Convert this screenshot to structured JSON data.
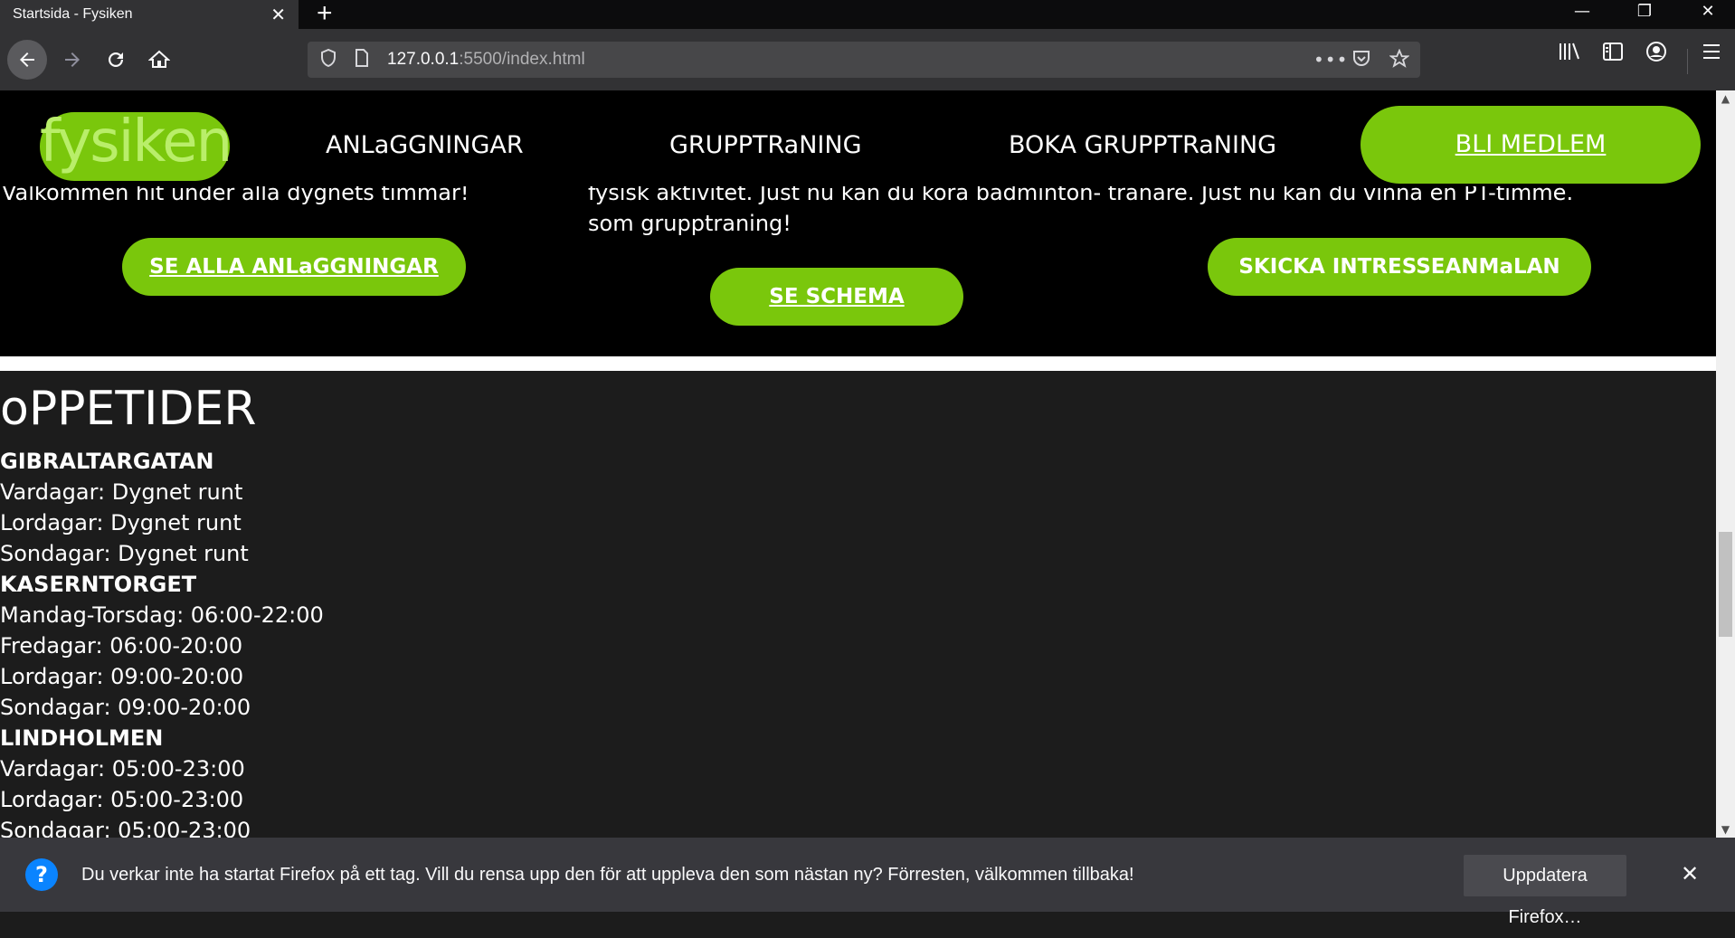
{
  "browser": {
    "tab_title": "Startsida - Fysiken",
    "tab_close": "✕",
    "new_tab": "+",
    "url_host": "127.0.0.1",
    "url_rest": ":5500/index.html",
    "page_actions": "•••",
    "window": {
      "minimize": "—",
      "restore": "❐",
      "close": "✕"
    }
  },
  "header": {
    "logo": "fysiken",
    "menu": [
      "ANLaGGNINGAR",
      "GRUPPTRaNING",
      "BOKA GRUPPTRaNING"
    ],
    "cta": "BLI MEDLEM"
  },
  "hero": {
    "col1_text": "Välkommen hit under alla dygnets timmar!",
    "col1_button": "SE ALLA ANLaGGNINGAR",
    "col2_text_line1": "fysisk aktivitet. Just nu kan du köra badminton- tränare. Just nu kan du vinna en PT-timme.",
    "col2_text_line2": "som grupptraning!",
    "col2_button": "SE SCHEMA",
    "col3_button": "SKICKA INTRESSEANMaLAN"
  },
  "hours": {
    "title": "oPPETIDER",
    "lines": [
      {
        "text": "GIBRALTARGATAN",
        "bold": true
      },
      {
        "text": "Vardagar: Dygnet runt",
        "bold": false
      },
      {
        "text": "Lordagar: Dygnet runt",
        "bold": false
      },
      {
        "text": "Sondagar: Dygnet runt",
        "bold": false
      },
      {
        "text": "KASERNTORGET",
        "bold": true
      },
      {
        "text": "Mandag-Torsdag: 06:00-22:00",
        "bold": false
      },
      {
        "text": "Fredagar: 06:00-20:00",
        "bold": false
      },
      {
        "text": "Lordagar: 09:00-20:00",
        "bold": false
      },
      {
        "text": "Sondagar: 09:00-20:00",
        "bold": false
      },
      {
        "text": "LINDHOLMEN",
        "bold": true
      },
      {
        "text": "Vardagar: 05:00-23:00",
        "bold": false
      },
      {
        "text": "Lordagar: 05:00-23:00",
        "bold": false
      },
      {
        "text": "Sondagar: 05:00-23:00",
        "bold": false
      }
    ]
  },
  "notification": {
    "icon": "?",
    "message": "Du verkar inte ha startat Firefox på ett tag. Vill du rensa upp den för att uppleva den som nästan ny? Förresten, välkommen tillbaka!",
    "button": "Uppdatera Firefox…",
    "close": "✕"
  }
}
